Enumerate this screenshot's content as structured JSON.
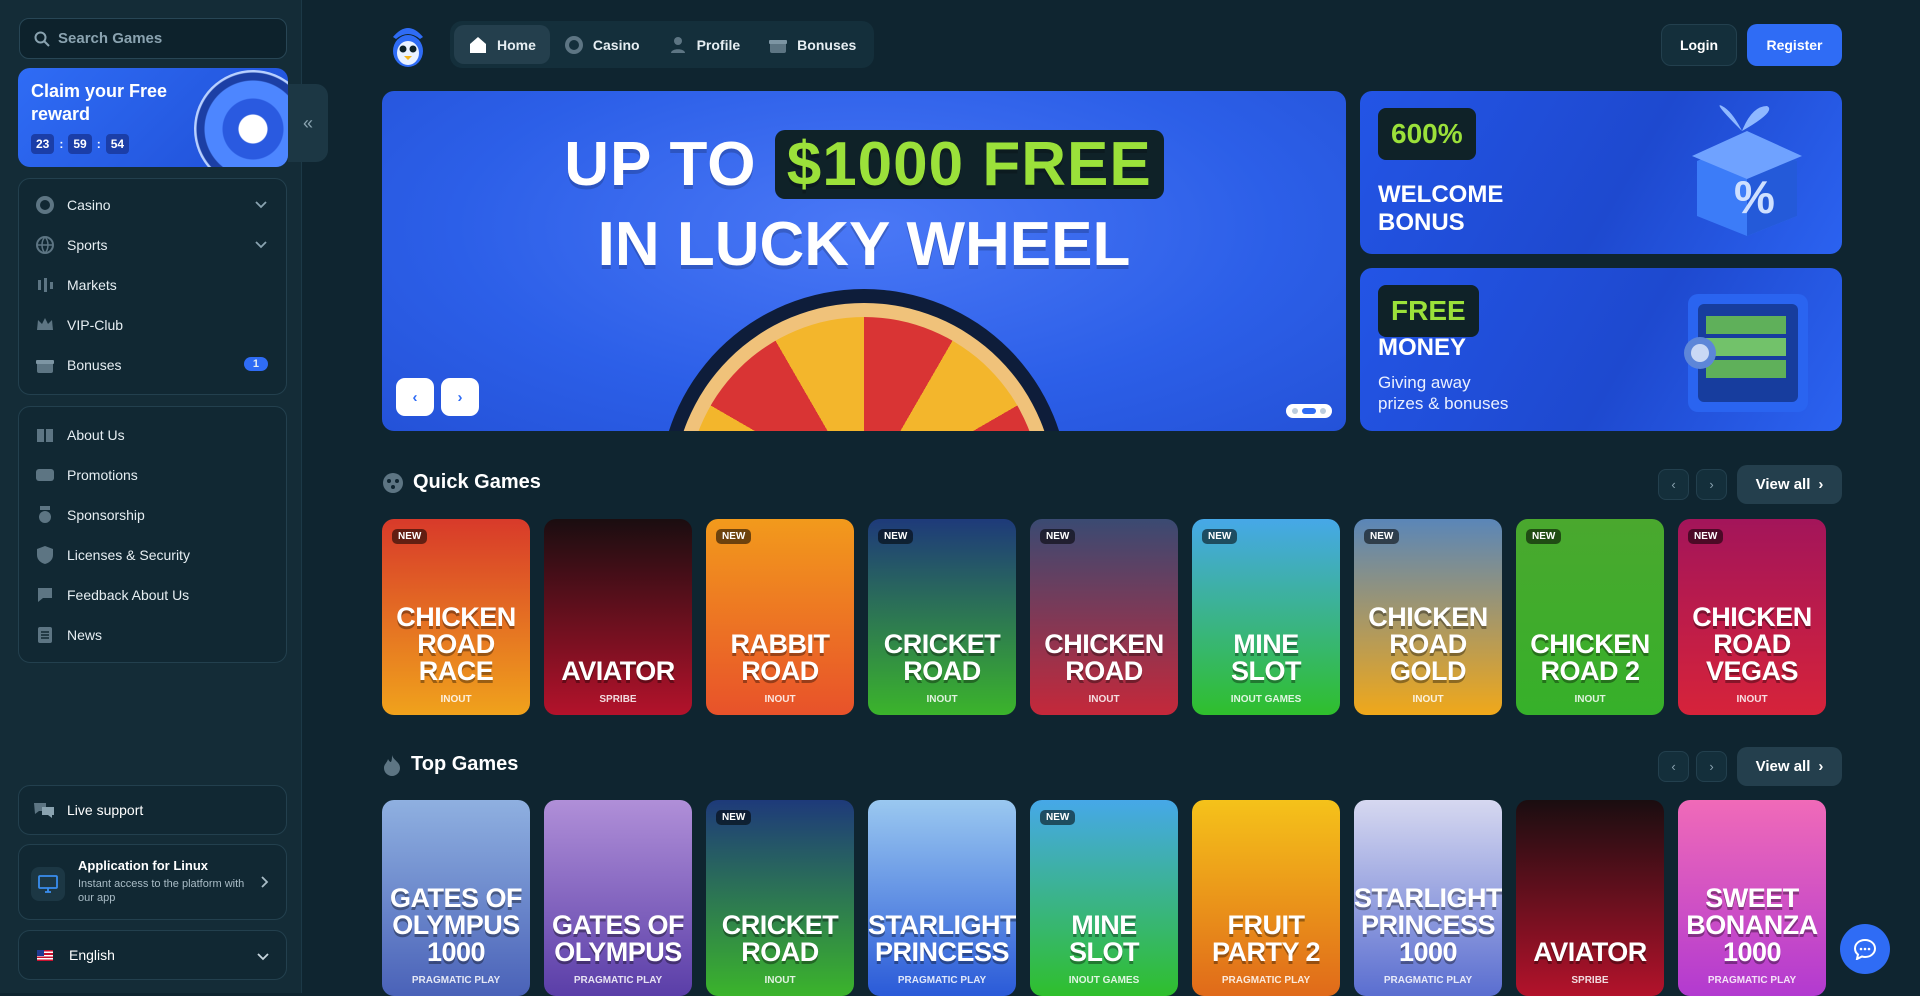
{
  "sidebar": {
    "search_placeholder": "Search Games",
    "reward": {
      "title": "Claim your Free reward",
      "hours": "23",
      "minutes": "59",
      "seconds": "54",
      "sep": ":"
    },
    "main_items": [
      {
        "label": "Casino",
        "icon": "chip-icon",
        "expandable": true
      },
      {
        "label": "Sports",
        "icon": "globe-icon",
        "expandable": true
      },
      {
        "label": "Markets",
        "icon": "candles-icon"
      },
      {
        "label": "VIP-Club",
        "icon": "crown-icon"
      },
      {
        "label": "Bonuses",
        "icon": "gift-icon",
        "badge": "1"
      }
    ],
    "info_items": [
      {
        "label": "About Us",
        "icon": "book-icon"
      },
      {
        "label": "Promotions",
        "icon": "tickets-icon"
      },
      {
        "label": "Sponsorship",
        "icon": "medal-icon"
      },
      {
        "label": "Licenses & Security",
        "icon": "shield-icon"
      },
      {
        "label": "Feedback About Us",
        "icon": "feedback-icon"
      },
      {
        "label": "News",
        "icon": "news-icon"
      }
    ],
    "support_label": "Live support",
    "app": {
      "title": "Application for Linux",
      "desc": "Instant access to the platform with our app"
    },
    "language": "English"
  },
  "header": {
    "tabs": [
      {
        "label": "Home",
        "icon": "home-icon"
      },
      {
        "label": "Casino",
        "icon": "chip-icon"
      },
      {
        "label": "Profile",
        "icon": "user-icon"
      },
      {
        "label": "Bonuses",
        "icon": "gift-icon"
      }
    ],
    "login": "Login",
    "register": "Register"
  },
  "hero": {
    "line1_prefix": "UP TO",
    "line1_highlight": "$1000 FREE",
    "line2": "IN LUCKY WHEEL",
    "prev": "‹",
    "next": "›"
  },
  "promos": [
    {
      "pill": "600%",
      "title_1": "WELCOME",
      "title_2": "BONUS"
    },
    {
      "pill": "FREE",
      "title_1": "MONEY",
      "sub_1": "Giving away",
      "sub_2": "prizes & bonuses"
    }
  ],
  "quick_games": {
    "title": "Quick Games",
    "view_all": "View all",
    "games": [
      {
        "name_1": "CHICKEN",
        "name_2": "ROAD RACE",
        "provider": "INOUT",
        "new": "NEW",
        "c1": "#d83a2a",
        "c2": "#f0a21c"
      },
      {
        "name_1": "",
        "name_2": "AVIATOR",
        "provider": "SPRIBE",
        "new": "",
        "c1": "#1a0d10",
        "c2": "#b3122b"
      },
      {
        "name_1": "RABBIT",
        "name_2": "ROAD",
        "provider": "INOUT",
        "new": "NEW",
        "c1": "#f29a1c",
        "c2": "#e8522a"
      },
      {
        "name_1": "CRICKET",
        "name_2": "ROAD",
        "provider": "INOUT",
        "new": "NEW",
        "c1": "#1e3a7a",
        "c2": "#3bb42b"
      },
      {
        "name_1": "CHICKEN",
        "name_2": "ROAD",
        "provider": "INOUT",
        "new": "NEW",
        "c1": "#3a4a72",
        "c2": "#c5283a"
      },
      {
        "name_1": "MINE",
        "name_2": "SLOT",
        "provider": "INOUT GAMES",
        "new": "NEW",
        "c1": "#46a8e8",
        "c2": "#2fbf2c"
      },
      {
        "name_1": "CHICKEN",
        "name_2": "ROAD GOLD",
        "provider": "INOUT",
        "new": "NEW",
        "c1": "#5a86b8",
        "c2": "#f0a81a"
      },
      {
        "name_1": "CHICKEN",
        "name_2": "ROAD 2",
        "provider": "INOUT",
        "new": "NEW",
        "c1": "#4aa82e",
        "c2": "#36b02a"
      },
      {
        "name_1": "CHICKEN",
        "name_2": "ROAD VEGAS",
        "provider": "INOUT",
        "new": "NEW",
        "c1": "#a3155a",
        "c2": "#d6233a"
      }
    ]
  },
  "top_games": {
    "title": "Top Games",
    "view_all": "View all",
    "games": [
      {
        "name_1": "GATES OF",
        "name_2": "OLYMPUS 1000",
        "provider": "PRAGMATIC PLAY",
        "new": "",
        "c1": "#8fb0e0",
        "c2": "#4a62b8"
      },
      {
        "name_1": "GATES OF",
        "name_2": "OLYMPUS",
        "provider": "PRAGMATIC PLAY",
        "new": "",
        "c1": "#b08fd8",
        "c2": "#5a3ea8"
      },
      {
        "name_1": "CRICKET",
        "name_2": "ROAD",
        "provider": "INOUT",
        "new": "NEW",
        "c1": "#1e3a7a",
        "c2": "#3bb42b"
      },
      {
        "name_1": "STARLIGHT",
        "name_2": "PRINCESS",
        "provider": "PRAGMATIC PLAY",
        "new": "",
        "c1": "#9ac8f0",
        "c2": "#2a5ad8"
      },
      {
        "name_1": "MINE",
        "name_2": "SLOT",
        "provider": "INOUT GAMES",
        "new": "NEW",
        "c1": "#46a8e8",
        "c2": "#2fbf2c"
      },
      {
        "name_1": "FRUIT",
        "name_2": "PARTY 2",
        "provider": "PRAGMATIC PLAY",
        "new": "",
        "c1": "#f5c21a",
        "c2": "#e06a1a"
      },
      {
        "name_1": "STARLIGHT",
        "name_2": "PRINCESS 1000",
        "provider": "PRAGMATIC PLAY",
        "new": "",
        "c1": "#d6d8f0",
        "c2": "#5a6ed0"
      },
      {
        "name_1": "",
        "name_2": "AVIATOR",
        "provider": "SPRIBE",
        "new": "",
        "c1": "#1a0d10",
        "c2": "#b3122b"
      },
      {
        "name_1": "SWEET",
        "name_2": "BONANZA 1000",
        "provider": "PRAGMATIC PLAY",
        "new": "",
        "c1": "#f06ab8",
        "c2": "#b23ad0"
      }
    ]
  },
  "colors": {
    "accent": "#2f6cf5",
    "lime": "#9be13a",
    "bg": "#0f2530"
  }
}
